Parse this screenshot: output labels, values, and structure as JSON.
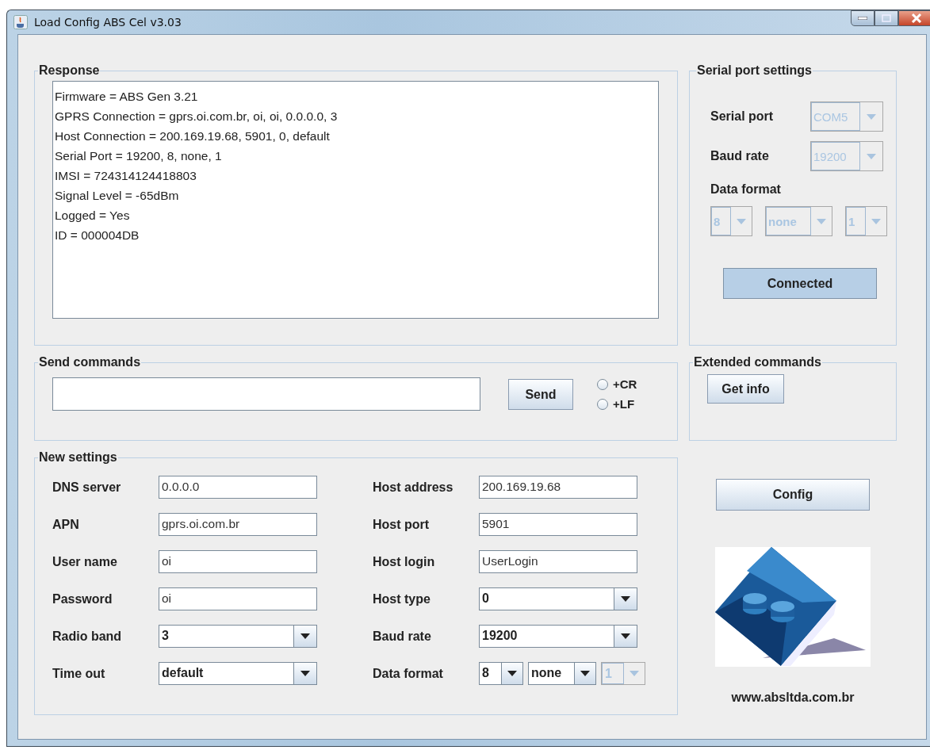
{
  "window": {
    "title": "Load Config ABS Cel v3.03"
  },
  "response": {
    "title": "Response",
    "lines": [
      "Firmware = ABS Gen 3.21",
      "GPRS Connection = gprs.oi.com.br, oi, oi, 0.0.0.0, 3",
      "Host Connection = 200.169.19.68, 5901, 0, default",
      "Serial Port = 19200, 8, none, 1",
      "IMSI = 724314124418803",
      "Signal Level = -65dBm",
      "Logged = Yes",
      "ID = 000004DB"
    ]
  },
  "serial": {
    "title": "Serial port settings",
    "fields": [
      {
        "label": "Serial port",
        "value": "COM5",
        "disabled": true
      },
      {
        "label": "Baud rate",
        "value": "19200",
        "disabled": true
      }
    ],
    "data_format": {
      "label": "Data format",
      "fields": [
        {
          "value": "8",
          "disabled": true
        },
        {
          "value": "none",
          "disabled": true
        },
        {
          "value": "1",
          "disabled": true
        }
      ]
    },
    "connect_button": {
      "label": "Connected",
      "pressed": true
    }
  },
  "send": {
    "title": "Send commands",
    "button": "Send",
    "options": [
      {
        "label": "+CR",
        "checked": false
      },
      {
        "label": "+LF",
        "checked": false
      }
    ]
  },
  "extended": {
    "title": "Extended commands",
    "buttons": [
      "Get info"
    ]
  },
  "new_settings": {
    "title": "New settings",
    "columns": [
      [
        {
          "kind": "text",
          "label": "DNS server",
          "value": "0.0.0.0"
        },
        {
          "kind": "text",
          "label": "APN",
          "value": "gprs.oi.com.br"
        },
        {
          "kind": "text",
          "label": "User name",
          "value": "oi"
        },
        {
          "kind": "text",
          "label": "Password",
          "value": "oi"
        },
        {
          "kind": "select",
          "label": "Radio band",
          "value": "3"
        },
        {
          "kind": "select",
          "label": "Time out",
          "value": "default"
        }
      ],
      [
        {
          "kind": "text",
          "label": "Host address",
          "value": "200.169.19.68"
        },
        {
          "kind": "text",
          "label": "Host port",
          "value": "5901"
        },
        {
          "kind": "text",
          "label": "Host login",
          "value": "UserLogin"
        },
        {
          "kind": "select",
          "label": "Host type",
          "value": "0"
        },
        {
          "kind": "select",
          "label": "Baud rate",
          "value": "19200"
        },
        {
          "kind": "multi",
          "label": "Data format",
          "fields": [
            {
              "value": "8",
              "disabled": false
            },
            {
              "value": "none",
              "disabled": false
            },
            {
              "value": "1",
              "disabled": true
            }
          ]
        }
      ]
    ]
  },
  "config_button": "Config",
  "website": "www.absltda.com.br"
}
